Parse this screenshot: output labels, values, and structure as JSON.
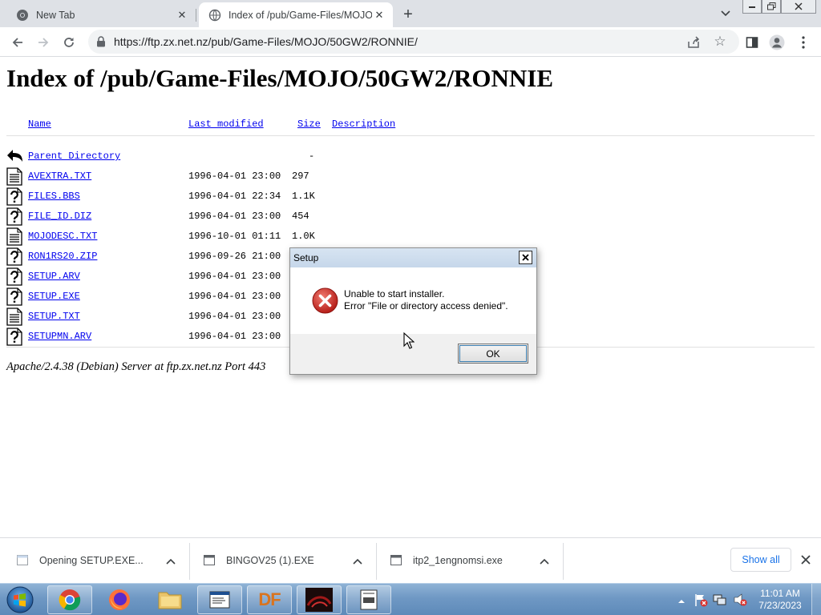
{
  "browser": {
    "tabs": [
      {
        "title": "New Tab",
        "icon": "chrome-icon",
        "active": false
      },
      {
        "title": "Index of /pub/Game-Files/MOJO/",
        "icon": "globe-icon",
        "active": true
      }
    ],
    "url": "https://ftp.zx.net.nz/pub/Game-Files/MOJO/50GW2/RONNIE/"
  },
  "page": {
    "heading": "Index of /pub/Game-Files/MOJO/50GW2/RONNIE",
    "columns": {
      "name": "Name",
      "last_modified": "Last modified",
      "size": "Size",
      "description": "Description"
    },
    "parent": {
      "name": "Parent Directory",
      "size": "-"
    },
    "files": [
      {
        "name": "AVEXTRA.TXT",
        "date": "1996-04-01 23:00",
        "size": "297",
        "icon": "text-file-icon"
      },
      {
        "name": "FILES.BBS",
        "date": "1996-04-01 22:34",
        "size": "1.1K",
        "icon": "unknown-file-icon"
      },
      {
        "name": "FILE_ID.DIZ",
        "date": "1996-04-01 23:00",
        "size": "454",
        "icon": "unknown-file-icon"
      },
      {
        "name": "MOJODESC.TXT",
        "date": "1996-10-01 01:11",
        "size": "1.0K",
        "icon": "text-file-icon"
      },
      {
        "name": "RON1RS20.ZIP",
        "date": "1996-09-26 21:00",
        "size": "",
        "icon": "unknown-file-icon"
      },
      {
        "name": "SETUP.ARV",
        "date": "1996-04-01 23:00",
        "size": "",
        "icon": "unknown-file-icon"
      },
      {
        "name": "SETUP.EXE",
        "date": "1996-04-01 23:00",
        "size": "",
        "icon": "unknown-file-icon"
      },
      {
        "name": "SETUP.TXT",
        "date": "1996-04-01 23:00",
        "size": "",
        "icon": "text-file-icon"
      },
      {
        "name": "SETUPMN.ARV",
        "date": "1996-04-01 23:00",
        "size": "",
        "icon": "unknown-file-icon"
      }
    ],
    "footer": "Apache/2.4.38 (Debian) Server at ftp.zx.net.nz Port 443"
  },
  "dialog": {
    "title": "Setup",
    "line1": "Unable to start installer.",
    "line2": "Error \"File or directory access denied\".",
    "ok": "OK"
  },
  "downloads": {
    "items": [
      {
        "name": "Opening SETUP.EXE..."
      },
      {
        "name": "BINGOV25 (1).EXE"
      },
      {
        "name": "itp2_1engnomsi.exe"
      }
    ],
    "show_all": "Show all"
  },
  "taskbar": {
    "apps": [
      "chrome-icon",
      "firefox-icon",
      "file-explorer-icon",
      "document-icon",
      "df-app-icon",
      "game-icon",
      "setup-app-icon"
    ],
    "df_label": "DF",
    "clock_time": "11:01 AM",
    "clock_date": "7/23/2023"
  },
  "colors": {
    "link": "#0000ee",
    "taskbar": "#6f98c4",
    "error_red": "#d9322e",
    "show_all_blue": "#1a73e8"
  }
}
